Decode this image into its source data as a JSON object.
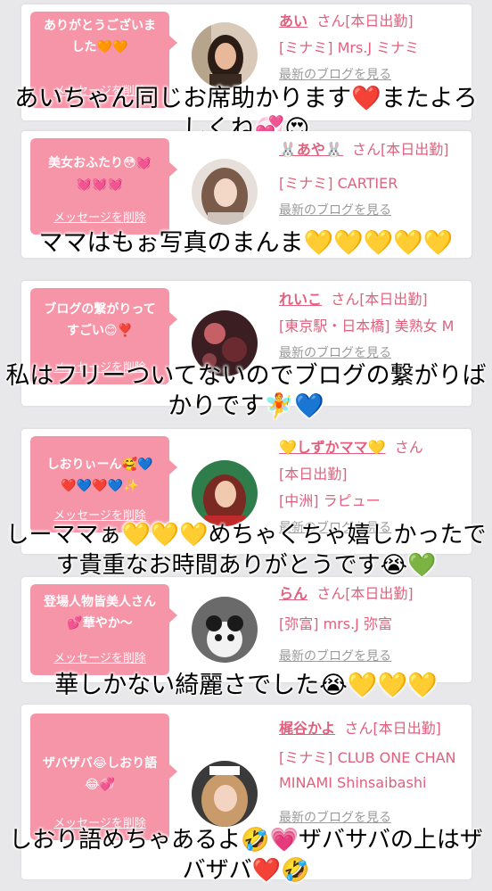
{
  "delete_label": "メッセージを削除",
  "cards": [
    {
      "message": "ありがとうございました🧡🧡",
      "name": "あい",
      "suffix": "さん[本日出勤]",
      "shop": "[ミナミ] Mrs.J ミナミ",
      "blog": "最新のブログを見る",
      "overlay": "あいちゃん同じお席助かります❤️またよろしくね💞😍"
    },
    {
      "message": "美女おふたり😳💓💓💓💓",
      "name": "🐰あや🐰",
      "suffix": "さん[本日出勤]",
      "shop": "[ミナミ] CARTIER",
      "blog": "最新のブログを見る",
      "overlay": "ママはもぉ写真のまんま💛💛💛💛💛"
    },
    {
      "message": "ブログの繋がりってすごい😊❣️",
      "name": "れいこ",
      "suffix": "さん[本日出勤]",
      "shop": "[東京駅・日本橋] 美熟女 M",
      "blog": "最新のブログを見る",
      "overlay": "私はフリーついてないのでブログの繋がりばかりです🧚💙"
    },
    {
      "message": "しおりぃーん🥰💙❤️💙❤️💙✨",
      "name": "💛しずかママ💛",
      "suffix": "さん",
      "suffix2": "[本日出勤]",
      "shop": "[中洲] ラピュー",
      "blog": "最新のブログを見る",
      "overlay": "しーママぁ💛💛💛めちゃくちゃ嬉しかったです貴重なお時間ありがとうです😭💚"
    },
    {
      "message": "登場人物皆美人さん💕華やか〜",
      "name": "らん",
      "suffix": "さん[本日出勤]",
      "shop": "[弥富] mrs.J 弥富",
      "blog": "最新のブログを見る",
      "overlay": "華しかない綺麗さでした😭💛💛💛"
    },
    {
      "message": "ザバザバ😂しおり語😂💞",
      "name": "梶谷かよ",
      "suffix": "さん[本日出勤]",
      "shop": "[ミナミ] CLUB ONE CHAN MINAMI Shinsaibashi",
      "blog": "最新のブログを見る",
      "overlay": "しおり語めちゃあるよ🤣💗ザバサバの上はザバザバ❤️🤣"
    }
  ],
  "colors": {
    "bubble": "#f795a8",
    "accent": "#e0607e",
    "background": "#e8e8ea"
  }
}
